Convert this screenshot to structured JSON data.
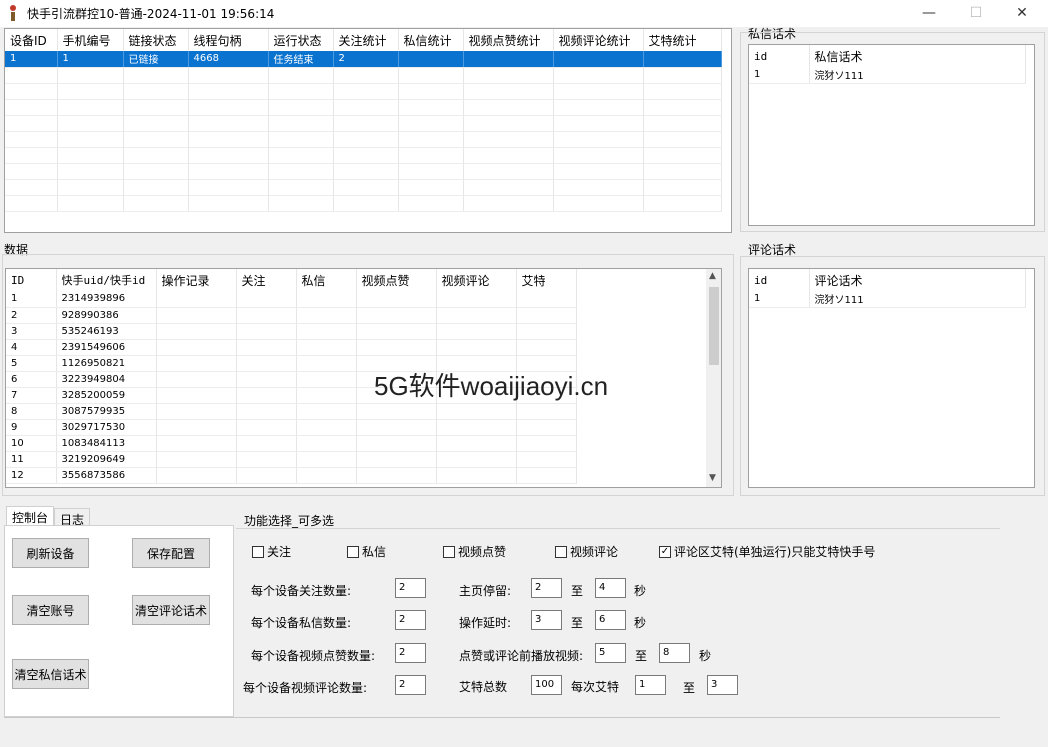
{
  "window": {
    "title": "快手引流群控10-普通-2024-11-01 19:56:14",
    "controls": [
      "—",
      "☐",
      "✕"
    ]
  },
  "devices": {
    "columns": [
      "设备ID",
      "手机编号",
      "链接状态",
      "线程句柄",
      "运行状态",
      "关注统计",
      "私信统计",
      "视频点赞统计",
      "视频评论统计",
      "艾特统计"
    ],
    "rows": [
      [
        "1",
        "1",
        "已链接",
        "4668",
        "任务结束",
        "2",
        "",
        "",
        "",
        ""
      ]
    ]
  },
  "private_msg_scripts": {
    "group_label": "私信话术",
    "columns": [
      "id",
      "私信话术"
    ],
    "rows": [
      [
        "1",
        "浣犲ソ111"
      ]
    ]
  },
  "comment_scripts": {
    "group_label": "评论话术",
    "columns": [
      "id",
      "评论话术"
    ],
    "rows": [
      [
        "1",
        "浣犲ソ111"
      ]
    ]
  },
  "data_table": {
    "group_label": "数据",
    "columns": [
      "ID",
      "快手uid/快手id",
      "操作记录",
      "关注",
      "私信",
      "视频点赞",
      "视频评论",
      "艾特"
    ],
    "rows": [
      [
        "1",
        "2314939896"
      ],
      [
        "2",
        "928990386"
      ],
      [
        "3",
        "535246193"
      ],
      [
        "4",
        "2391549606"
      ],
      [
        "5",
        "1126950821"
      ],
      [
        "6",
        "3223949804"
      ],
      [
        "7",
        "3285200059"
      ],
      [
        "8",
        "3087579935"
      ],
      [
        "9",
        "3029717530"
      ],
      [
        "10",
        "1083484113"
      ],
      [
        "11",
        "3219209649"
      ],
      [
        "12",
        "3556873586"
      ]
    ]
  },
  "watermark": "5G软件woaijiaoyi.cn",
  "tabs": [
    "控制台",
    "日志"
  ],
  "buttons": {
    "refresh": "刷新设备",
    "save": "保存配置",
    "clear_account": "清空账号",
    "clear_comment": "清空评论话术",
    "clear_private": "清空私信话术"
  },
  "functions": {
    "group_label": "功能选择_可多选",
    "checkboxes": [
      {
        "label": "关注",
        "checked": false
      },
      {
        "label": "私信",
        "checked": false
      },
      {
        "label": "视频点赞",
        "checked": false
      },
      {
        "label": "视频评论",
        "checked": false
      },
      {
        "label": "评论区艾特(单独运行)只能艾特快手号",
        "checked": true
      }
    ],
    "follow_count_label": "每个设备关注数量:",
    "follow_count": "2",
    "private_count_label": "每个设备私信数量:",
    "private_count": "2",
    "like_count_label": "每个设备视频点赞数量:",
    "like_count": "2",
    "comment_count_label": "每个设备视频评论数量:",
    "comment_count": "2",
    "home_stay_label": "主页停留:",
    "home_stay_min": "2",
    "home_stay_max": "4",
    "op_delay_label": "操作延时:",
    "op_delay_min": "3",
    "op_delay_max": "6",
    "play_label": "点赞或评论前播放视频:",
    "play_min": "5",
    "play_max": "8",
    "at_total_label": "艾特总数",
    "at_total": "100",
    "at_each_label": "每次艾特",
    "at_each_min": "1",
    "at_each_max": "3",
    "to": "至",
    "sec": "秒"
  }
}
